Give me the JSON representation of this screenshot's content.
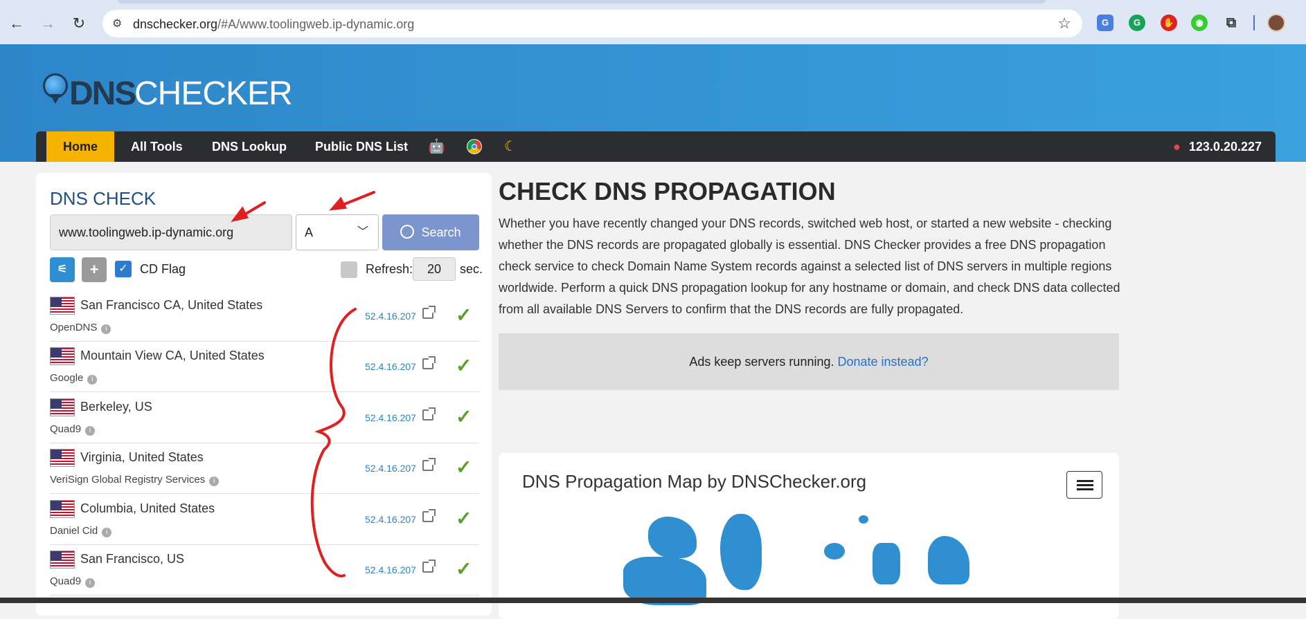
{
  "browser": {
    "url_host": "dnschecker.org",
    "url_path": "/#A/www.toolingweb.ip-dynamic.org"
  },
  "header": {
    "logo_dns": "DNS",
    "logo_checker": "CHECKER"
  },
  "nav": {
    "items": [
      "Home",
      "All Tools",
      "DNS Lookup",
      "Public DNS List"
    ],
    "ip": "123.0.20.227"
  },
  "dns_check": {
    "title": "DNS CHECK",
    "domain_value": "www.toolingweb.ip-dynamic.org",
    "record_type": "A",
    "search_label": "Search",
    "cd_flag_label": "CD Flag",
    "cd_flag_checked": true,
    "refresh_label": "Refresh:",
    "refresh_value": "20",
    "refresh_unit": "sec."
  },
  "servers": [
    {
      "location": "San Francisco CA, United States",
      "provider": "OpenDNS",
      "ip": "52.4.16.207"
    },
    {
      "location": "Mountain View CA, United States",
      "provider": "Google",
      "ip": "52.4.16.207"
    },
    {
      "location": "Berkeley, US",
      "provider": "Quad9",
      "ip": "52.4.16.207"
    },
    {
      "location": "Virginia, United States",
      "provider": "VeriSign Global Registry Services",
      "ip": "52.4.16.207"
    },
    {
      "location": "Columbia, United States",
      "provider": "Daniel Cid",
      "ip": "52.4.16.207"
    },
    {
      "location": "San Francisco, US",
      "provider": "Quad9",
      "ip": "52.4.16.207"
    }
  ],
  "main": {
    "title": "CHECK DNS PROPAGATION",
    "description": "Whether you have recently changed your DNS records, switched web host, or started a new website - checking whether the DNS records are propagated globally is essential. DNS Checker provides a free DNS propagation check service to check Domain Name System records against a selected list of DNS servers in multiple regions worldwide. Perform a quick DNS propagation lookup for any hostname or domain, and check DNS data collected from all available DNS Servers to confirm that the DNS records are fully propagated.",
    "ad_text": "Ads keep servers running.",
    "ad_link": "Donate instead?",
    "map_title": "DNS Propagation Map by DNSChecker.org"
  },
  "colors": {
    "header_blue": "#3aa1de",
    "nav_dark": "#2c2d31",
    "home_active": "#f6b300",
    "ok_green": "#5a9f2e",
    "annotation_red": "#e02020"
  }
}
